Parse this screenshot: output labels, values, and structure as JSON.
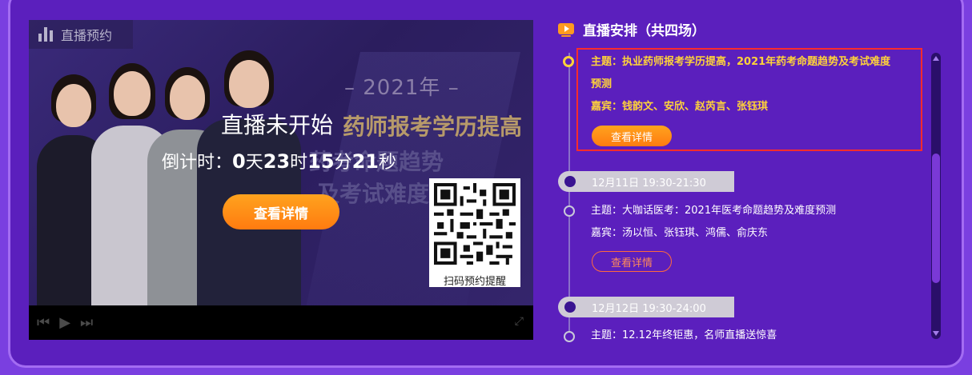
{
  "video": {
    "live_tag": "直播预约",
    "year_text": "– 2021年 –",
    "promo_line1": "药师报考学历提高",
    "promo_line2": "药考命题趋势",
    "promo_line3": "及考试难度",
    "status_title": "直播未开始",
    "countdown": {
      "label": "倒计时：",
      "days": "0",
      "days_unit": "天",
      "hours": "23",
      "hours_unit": "时",
      "minutes": "15",
      "minutes_unit": "分",
      "seconds": "21",
      "seconds_unit": "秒"
    },
    "detail_button": "查看详情",
    "qr_caption": "扫码预约提醒",
    "controls": {
      "prev": "⏮",
      "play": "▶",
      "next": "⏭",
      "fullscreen": "⤢"
    }
  },
  "schedule": {
    "title": "直播安排（共四场）",
    "sessions": [
      {
        "topic_line1": "主题：执业药师报考学历提高，2021年药考命题趋势及考试难度",
        "topic_line2": "预测",
        "guests": "嘉宾：钱韵文、安欣、赵芮言、张钰琪",
        "button": "查看详情"
      },
      {
        "date": "12月11日 19:30-21:30",
        "topic": "主题：大咖话医考：2021年医考命题趋势及难度预测",
        "guests": "嘉宾：汤以恒、张钰琪、鸿儒、俞庆东",
        "button": "查看详情"
      },
      {
        "date": "12月12日 19:30-24:00",
        "topic": "主题：12.12年终钜惠，名师直播送惊喜"
      }
    ]
  },
  "colors": {
    "panel_bg": "#5b1fbd",
    "highlight_text": "#ffd23a",
    "button_orange": "#ff8c14",
    "highlight_border": "#ff2c2c"
  }
}
